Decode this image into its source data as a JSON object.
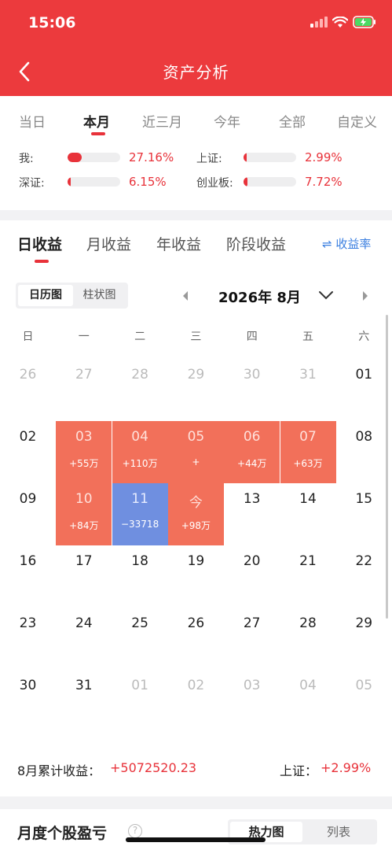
{
  "status": {
    "time": "15:06"
  },
  "header": {
    "title": "资产分析"
  },
  "period_tabs": [
    "当日",
    "本月",
    "近三月",
    "今年",
    "全部",
    "自定义"
  ],
  "comparison": [
    {
      "label": "我:",
      "value": "27.16%",
      "fill": 0.27
    },
    {
      "label": "上证:",
      "value": "2.99%",
      "fill": 0.03
    },
    {
      "label": "深证:",
      "value": "6.15%",
      "fill": 0.06
    },
    {
      "label": "创业板:",
      "value": "7.72%",
      "fill": 0.08
    }
  ],
  "return_tabs": [
    "日收益",
    "月收益",
    "年收益",
    "阶段收益"
  ],
  "rate_link": "⇌ 收益率",
  "view_toggle": [
    "日历图",
    "柱状图"
  ],
  "calendar": {
    "month_title": "2026年 8月",
    "weekdays": [
      "日",
      "一",
      "二",
      "三",
      "四",
      "五",
      "六"
    ],
    "rows": [
      [
        {
          "d": "26",
          "dim": true
        },
        {
          "d": "27",
          "dim": true
        },
        {
          "d": "28",
          "dim": true
        },
        {
          "d": "29",
          "dim": true
        },
        {
          "d": "30",
          "dim": true
        },
        {
          "d": "31",
          "dim": true
        },
        {
          "d": "01"
        }
      ],
      [
        {
          "d": "02"
        },
        {
          "d": "03",
          "v": "+55万",
          "t": "pos"
        },
        {
          "d": "04",
          "v": "+110万",
          "t": "pos"
        },
        {
          "d": "05",
          "v": "+",
          "t": "pos"
        },
        {
          "d": "06",
          "v": "+44万",
          "t": "pos"
        },
        {
          "d": "07",
          "v": "+63万",
          "t": "pos"
        },
        {
          "d": "08"
        }
      ],
      [
        {
          "d": "09"
        },
        {
          "d": "10",
          "v": "+84万",
          "t": "pos"
        },
        {
          "d": "11",
          "v": "−33718",
          "t": "neg"
        },
        {
          "d": "今",
          "v": "+98万",
          "t": "pos"
        },
        {
          "d": "13"
        },
        {
          "d": "14"
        },
        {
          "d": "15"
        }
      ],
      [
        {
          "d": "16"
        },
        {
          "d": "17"
        },
        {
          "d": "18"
        },
        {
          "d": "19"
        },
        {
          "d": "20"
        },
        {
          "d": "21"
        },
        {
          "d": "22"
        }
      ],
      [
        {
          "d": "23"
        },
        {
          "d": "24"
        },
        {
          "d": "25"
        },
        {
          "d": "26"
        },
        {
          "d": "27"
        },
        {
          "d": "28"
        },
        {
          "d": "29"
        }
      ],
      [
        {
          "d": "30"
        },
        {
          "d": "31"
        },
        {
          "d": "01",
          "dim": true
        },
        {
          "d": "02",
          "dim": true
        },
        {
          "d": "03",
          "dim": true
        },
        {
          "d": "04",
          "dim": true
        },
        {
          "d": "05",
          "dim": true
        }
      ]
    ]
  },
  "summary": {
    "month_label": "8月累计收益：",
    "month_value": "+5072520.23",
    "index_label": "上证：",
    "index_value": "+2.99%"
  },
  "monthly_section": {
    "title": "月度个股盈亏",
    "help": "?",
    "toggle": [
      "热力图",
      "列表"
    ]
  },
  "colors": {
    "brand_red": "#ec3a3d",
    "gain": "#f2705a",
    "loss": "#6f8fe0"
  }
}
